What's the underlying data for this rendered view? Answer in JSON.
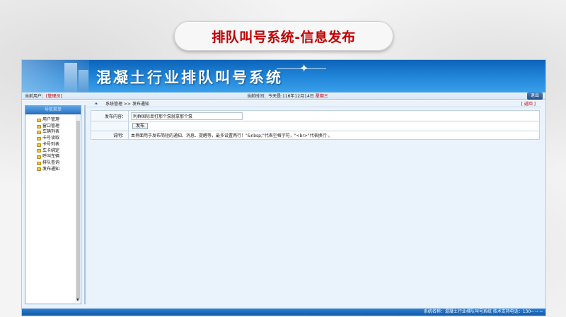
{
  "slide": {
    "title": "排队叫号系统-信息发布"
  },
  "header": {
    "system_title": "混凝土行业排队叫号系统"
  },
  "status": {
    "user_label": "当前用户：",
    "user_value": "[管理员]",
    "time_label": "当前时间：",
    "time_value": "今天是:116年12月14日",
    "weekday": "星期三",
    "logout_label": "退出"
  },
  "sidebar": {
    "heading": "导航菜单",
    "items": [
      {
        "label": "用户管理"
      },
      {
        "label": "窗口管理"
      },
      {
        "label": "车辆列表"
      },
      {
        "label": "卡号读取"
      },
      {
        "label": "卡号列表"
      },
      {
        "label": "车卡绑定"
      },
      {
        "label": "呼叫车辆"
      },
      {
        "label": "排队查询"
      },
      {
        "label": "发布通知"
      }
    ]
  },
  "breadcrumb": {
    "text": "系统管理 >> 发布通知",
    "back_label": "[ 返回 ]"
  },
  "form": {
    "content_label": "发布内容：",
    "content_value": "利群国际单打那个泵就拿那个泵",
    "publish_label": "发布",
    "desc_label": "说明：",
    "desc_text": "本界面用于发布简短的通知、消息、提醒等，最多设置两行！\"&nbsp;\"代表空格字符，\"<br>\"代表换行 。"
  },
  "footer": {
    "text": "系统名称：混凝土行业排队叫号系统   技术支持电话：130-- -- --"
  }
}
